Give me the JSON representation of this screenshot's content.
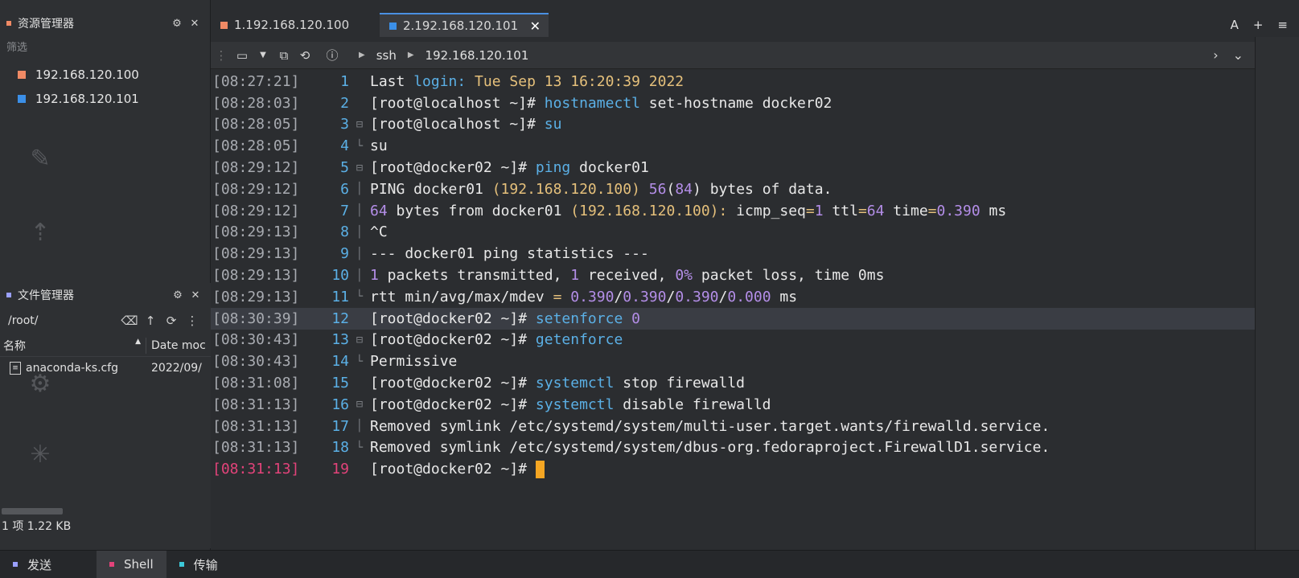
{
  "sidebar": {
    "explorer_title": "资源管理器",
    "filter_placeholder": "筛选",
    "sessions": [
      {
        "label": "192.168.120.100",
        "color": "#f08a65"
      },
      {
        "label": "192.168.120.101",
        "color": "#3b8fe8"
      }
    ],
    "files_title": "文件管理器",
    "path": "/root/",
    "columns": [
      "名称",
      "Date moc"
    ],
    "files": [
      {
        "name": "anaconda-ks.cfg",
        "date": "2022/09/"
      }
    ],
    "status": "1 项 1.22 KB"
  },
  "tabs": [
    {
      "label": "1.192.168.120.100",
      "color": "#f08a65"
    },
    {
      "label": "2.192.168.120.101",
      "color": "#3b8fe8"
    }
  ],
  "tab_close": "✕",
  "toolbar": {
    "crumbs": [
      "ssh",
      "192.168.120.101"
    ]
  },
  "bottom_tabs": [
    {
      "label": "发送",
      "color": "#9aa0ff"
    },
    {
      "label": "Shell",
      "color": "#e3437a"
    },
    {
      "label": "传输",
      "color": "#3cc8d8"
    }
  ],
  "terminal": {
    "lines": [
      {
        "ts": "[08:27:21]",
        "n": "1",
        "fold": ""
      },
      {
        "ts": "[08:28:03]",
        "n": "2",
        "fold": ""
      },
      {
        "ts": "[08:28:05]",
        "n": "3",
        "fold": "⊟"
      },
      {
        "ts": "[08:28:05]",
        "n": "4",
        "fold": "└"
      },
      {
        "ts": "[08:29:12]",
        "n": "5",
        "fold": "⊟"
      },
      {
        "ts": "[08:29:12]",
        "n": "6",
        "fold": "│"
      },
      {
        "ts": "[08:29:12]",
        "n": "7",
        "fold": "│"
      },
      {
        "ts": "[08:29:13]",
        "n": "8",
        "fold": "│"
      },
      {
        "ts": "[08:29:13]",
        "n": "9",
        "fold": "│"
      },
      {
        "ts": "[08:29:13]",
        "n": "10",
        "fold": "│"
      },
      {
        "ts": "[08:29:13]",
        "n": "11",
        "fold": "└"
      },
      {
        "ts": "[08:30:39]",
        "n": "12",
        "fold": ""
      },
      {
        "ts": "[08:30:43]",
        "n": "13",
        "fold": "⊟"
      },
      {
        "ts": "[08:30:43]",
        "n": "14",
        "fold": "└"
      },
      {
        "ts": "[08:31:08]",
        "n": "15",
        "fold": ""
      },
      {
        "ts": "[08:31:13]",
        "n": "16",
        "fold": "⊟"
      },
      {
        "ts": "[08:31:13]",
        "n": "17",
        "fold": "│"
      },
      {
        "ts": "[08:31:13]",
        "n": "18",
        "fold": "└"
      },
      {
        "ts": "[08:31:13]",
        "n": "19",
        "fold": ""
      }
    ],
    "text": {
      "l1": [
        "Last ",
        "login: ",
        "Tue Sep 13 16:20:39 2022"
      ],
      "prompt_local": "[root@localhost ~]# ",
      "prompt_docker": "[root@docker02 ~]# ",
      "l2": [
        "hostnamectl",
        " set",
        "-hostname docker02"
      ],
      "l3": "su",
      "l4": "su",
      "l5": [
        "ping",
        " docker01"
      ],
      "l6": [
        "PING docker01 ",
        "(192.168.120.100)",
        " ",
        "56",
        "(",
        "84",
        ") bytes of data."
      ],
      "l7": [
        "64",
        " bytes from docker01 ",
        "(192.168.120.100):",
        " icmp_seq",
        "=",
        "1",
        " ttl",
        "=",
        "64",
        " time",
        "=",
        "0.390",
        " ms"
      ],
      "l8": "^C",
      "l9": "--- docker01 ping statistics ---",
      "l10": [
        "1",
        " packets transmitted, ",
        "1",
        " received, ",
        "0%",
        " packet loss, time 0ms"
      ],
      "l11": [
        "rtt min/avg/max/mdev ",
        "=",
        " ",
        "0.390",
        "/",
        "0.390",
        "/",
        "0.390",
        "/",
        "0.000",
        " ms"
      ],
      "l12": [
        "setenforce",
        " ",
        "0"
      ],
      "l13": "getenforce",
      "l14": "Permissive",
      "l15": [
        "systemctl",
        " stop firewalld"
      ],
      "l16": [
        "systemctl",
        " disable firewalld"
      ],
      "l17": "Removed symlink /etc/systemd/system/multi-user.target.wants/firewalld.service.",
      "l18": [
        "Removed symlink /etc/systemd/system/dbus",
        "-org.fedoraproject.FirewallD1.service."
      ]
    }
  }
}
